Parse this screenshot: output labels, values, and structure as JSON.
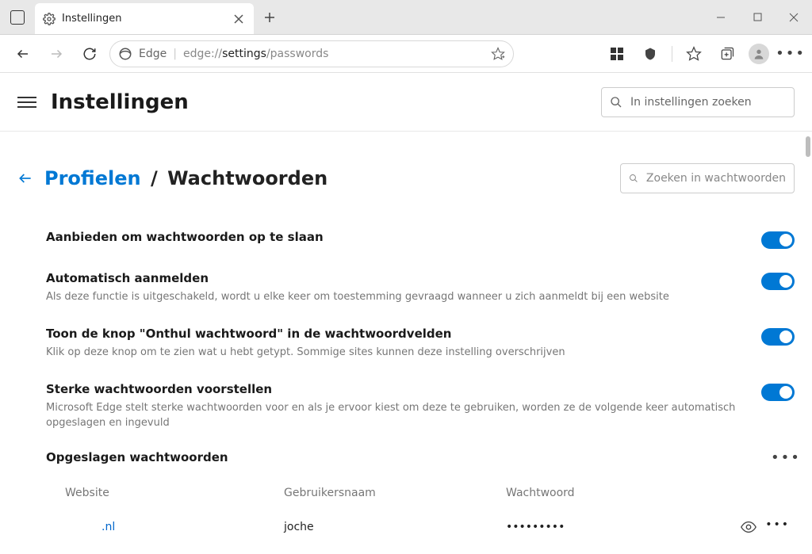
{
  "tab": {
    "title": "Instellingen"
  },
  "address": {
    "label": "Edge",
    "url_prefix": "edge://",
    "url_bold": "settings",
    "url_suffix": "/passwords"
  },
  "header": {
    "title": "Instellingen",
    "search_placeholder": "In instellingen zoeken"
  },
  "breadcrumb": {
    "parent": "Profielen",
    "current": "Wachtwoorden"
  },
  "password_search_placeholder": "Zoeken in wachtwoorden",
  "settings": [
    {
      "title": "Aanbieden om wachtwoorden op te slaan",
      "desc": "",
      "on": true
    },
    {
      "title": "Automatisch aanmelden",
      "desc": "Als deze functie is uitgeschakeld, wordt u elke keer om toestemming gevraagd wanneer u zich aanmeldt bij een website",
      "on": true
    },
    {
      "title": "Toon de knop \"Onthul wachtwoord\" in de wachtwoordvelden",
      "desc": "Klik op deze knop om te zien wat u hebt getypt. Sommige sites kunnen deze instelling overschrijven",
      "on": true
    },
    {
      "title": "Sterke wachtwoorden voorstellen",
      "desc": "Microsoft Edge stelt sterke wachtwoorden voor en als je ervoor kiest om deze te gebruiken, worden ze de volgende keer automatisch opgeslagen en ingevuld",
      "on": true
    }
  ],
  "saved": {
    "title": "Opgeslagen wachtwoorden",
    "columns": {
      "website": "Website",
      "username": "Gebruikersnaam",
      "password": "Wachtwoord"
    },
    "rows": [
      {
        "website": ".nl",
        "username": "joche",
        "password": "•••••••••"
      }
    ]
  }
}
